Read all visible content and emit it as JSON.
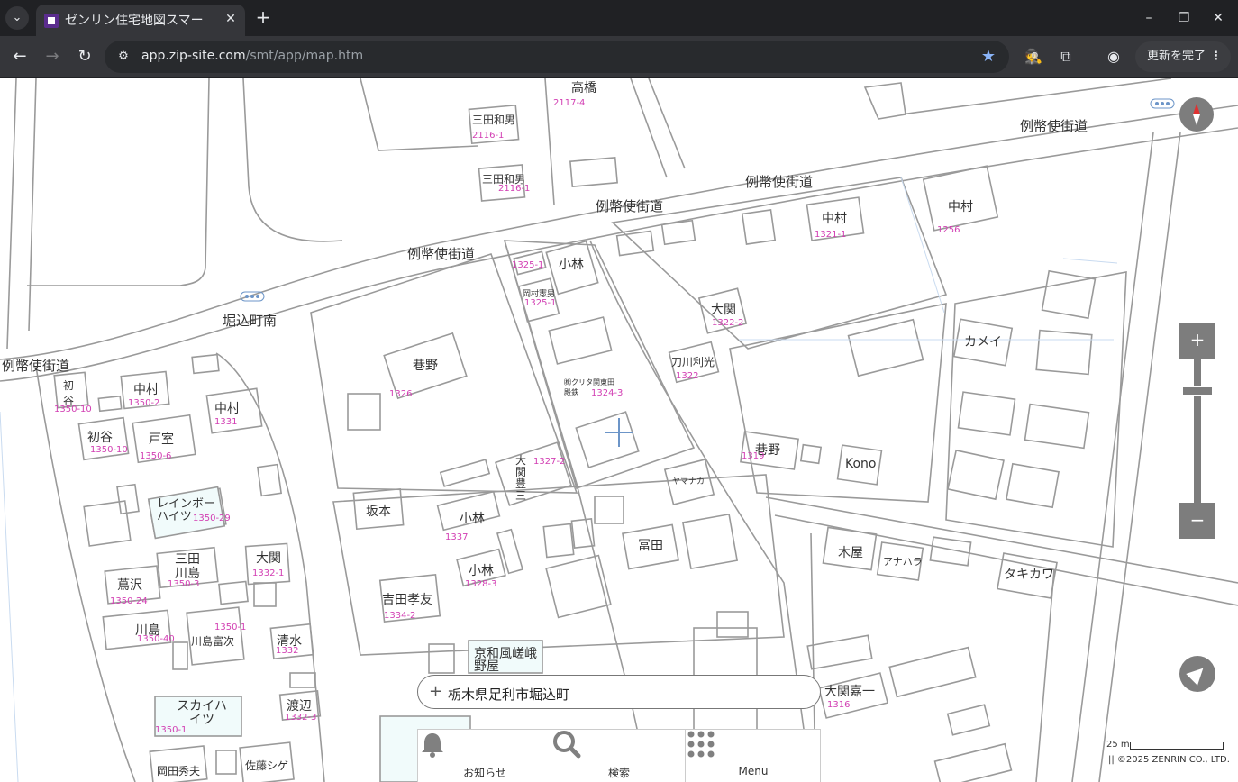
{
  "browser": {
    "tab_title": "ゼンリン住宅地図スマー",
    "url_host": "app.zip-site.com",
    "url_path": "/smt/app/map.htm",
    "update_button": "更新を完了"
  },
  "map": {
    "roads": [
      "例幣使街道",
      "例幣使街道",
      "例幣使街道",
      "例幣使街道",
      "例幣使街道"
    ],
    "area_name": "堀込町南",
    "buildings": [
      {
        "name": "三田和男",
        "num": "2116-1"
      },
      {
        "name": "三田和男",
        "num": "2116-1"
      },
      {
        "name": "高橋",
        "num": "2117-4"
      },
      {
        "name": "中村",
        "num": "1321-1"
      },
      {
        "name": "中村",
        "num": "1256"
      },
      {
        "name": "小林",
        "num": "1325-1"
      },
      {
        "name": "岡村憲男",
        "num": "1325-1"
      },
      {
        "name": "大関",
        "num": "1322-2"
      },
      {
        "name": "刀川利光",
        "num": "1322"
      },
      {
        "name": "巷野",
        "num": "1326"
      },
      {
        "name": "㈱クリタ関東田殿鉄",
        "num": "1324-3"
      },
      {
        "name": "カメイ",
        "num": ""
      },
      {
        "name": "巷野",
        "num": "1319"
      },
      {
        "name": "Kono",
        "num": ""
      },
      {
        "name": "初谷",
        "num": "1350-10"
      },
      {
        "name": "中村",
        "num": "1350-2"
      },
      {
        "name": "中村",
        "num": "1331"
      },
      {
        "name": "初谷",
        "num": "1350-10"
      },
      {
        "name": "戸室",
        "num": "1350-6"
      },
      {
        "name": "大関豊三",
        "num": "1327-2"
      },
      {
        "name": "坂本",
        "num": ""
      },
      {
        "name": "小林",
        "num": "1337"
      },
      {
        "name": "ヤマナカ",
        "num": ""
      },
      {
        "name": "レインボーハイツ",
        "num": "1350-29"
      },
      {
        "name": "三田川島",
        "num": "1350-3"
      },
      {
        "name": "大関",
        "num": "1332-1"
      },
      {
        "name": "冨田",
        "num": ""
      },
      {
        "name": "木屋",
        "num": ""
      },
      {
        "name": "アナハラ",
        "num": ""
      },
      {
        "name": "タキカワ",
        "num": ""
      },
      {
        "name": "蔦沢",
        "num": "1350-24"
      },
      {
        "name": "小林",
        "num": "1328-3"
      },
      {
        "name": "吉田孝友",
        "num": "1334-2"
      },
      {
        "name": "川島",
        "num": "1350-40"
      },
      {
        "name": "川島富次",
        "num": "1350-1"
      },
      {
        "name": "清水",
        "num": "1332"
      },
      {
        "name": "京和風嵯峨野屋",
        "num": ""
      },
      {
        "name": "大関嘉一",
        "num": "1316"
      },
      {
        "name": "スカイハイツ",
        "num": "1350-1"
      },
      {
        "name": "渡辺",
        "num": "1332-3"
      },
      {
        "name": "岡田秀夫",
        "num": ""
      },
      {
        "name": "佐藤シゲ",
        "num": ""
      }
    ],
    "address": "栃木県足利市堀込町",
    "scale_label": "25 m",
    "copyright": "©2025 ZENRIN CO., LTD."
  },
  "bottom_menu": [
    {
      "label": "お知らせ",
      "icon": "bell-icon"
    },
    {
      "label": "検索",
      "icon": "search-icon"
    },
    {
      "label": "Menu",
      "icon": "grid-icon"
    }
  ]
}
